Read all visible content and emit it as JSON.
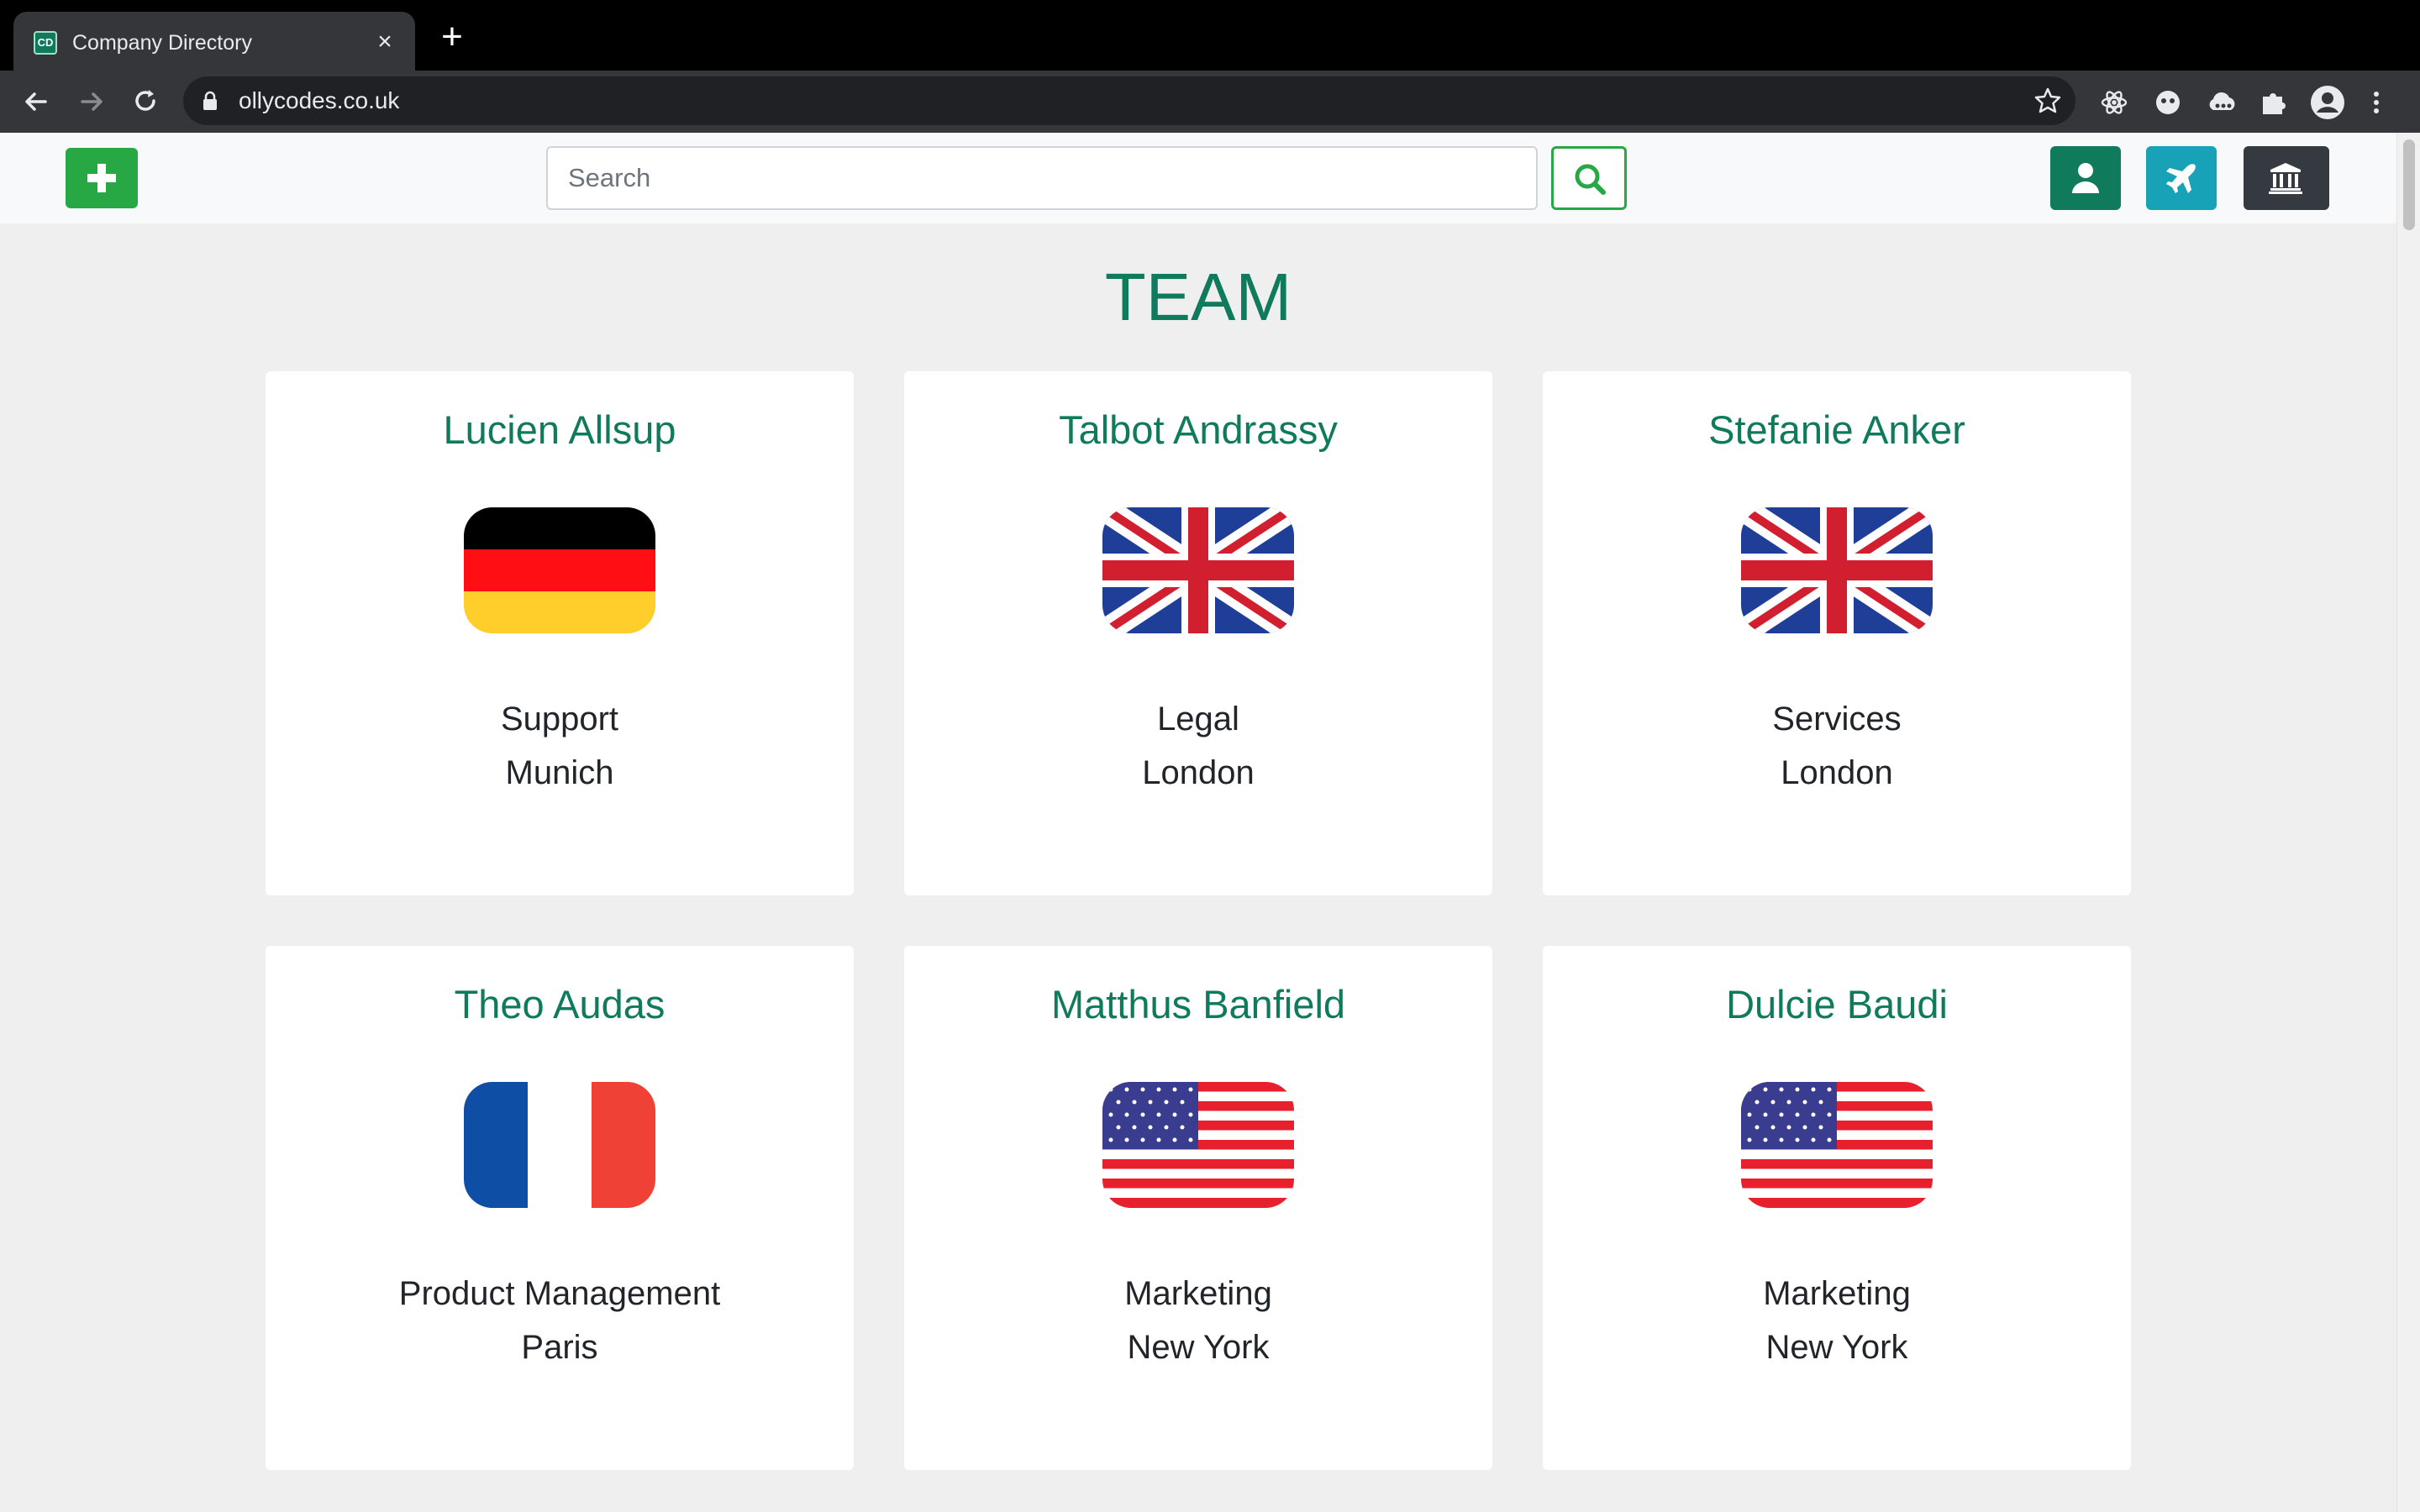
{
  "browser": {
    "tab_title": "Company Directory",
    "tab_favicon_text": "CD",
    "url": "ollycodes.co.uk"
  },
  "header": {
    "search_placeholder": "Search",
    "search_value": ""
  },
  "colors": {
    "brand_green": "#0f7a5c",
    "add_green": "#28a745",
    "info_teal": "#17a2b8",
    "dark": "#343a40"
  },
  "page": {
    "title": "TEAM"
  },
  "employees": [
    {
      "name": "Lucien Allsup",
      "department": "Support",
      "location": "Munich",
      "flag": "germany-flag"
    },
    {
      "name": "Talbot Andrassy",
      "department": "Legal",
      "location": "London",
      "flag": "uk-flag"
    },
    {
      "name": "Stefanie Anker",
      "department": "Services",
      "location": "London",
      "flag": "uk-flag"
    },
    {
      "name": "Theo Audas",
      "department": "Product Management",
      "location": "Paris",
      "flag": "france-flag"
    },
    {
      "name": "Matthus Banfield",
      "department": "Marketing",
      "location": "New York",
      "flag": "usa-flag"
    },
    {
      "name": "Dulcie Baudi",
      "department": "Marketing",
      "location": "New York",
      "flag": "usa-flag"
    }
  ]
}
